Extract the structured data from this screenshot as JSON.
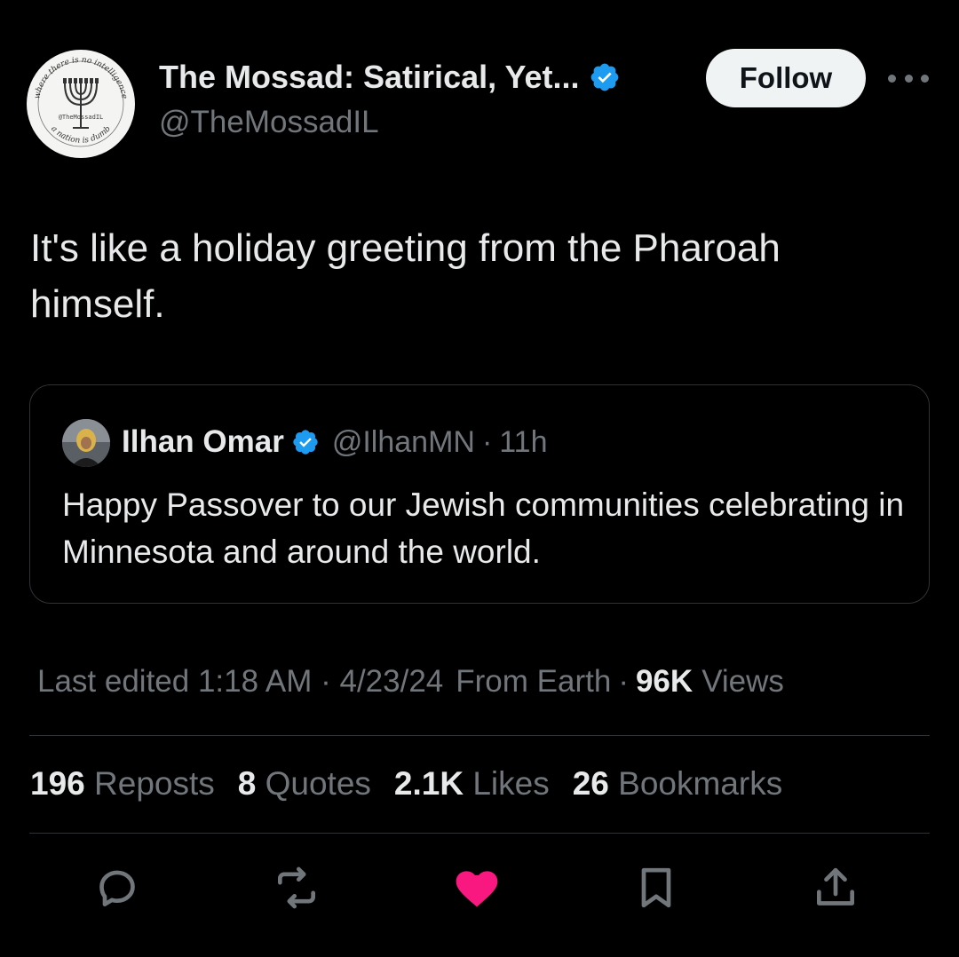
{
  "author": {
    "display_name": "The Mossad: Satirical, Yet...",
    "handle": "@TheMossadIL",
    "avatar": {
      "ring_top_text": "where there is no intelligence",
      "ring_bottom_text": "a nation is dumb",
      "center_text": "@TheMossadIL"
    }
  },
  "follow_label": "Follow",
  "tweet_text": "It's like a holiday greeting from the Pharoah himself.",
  "quote": {
    "name": "Ilhan Omar",
    "handle": "@IlhanMN",
    "separator": "·",
    "time": "11h",
    "text": "Happy Passover to our Jewish communities celebrating in Minnesota and around the world."
  },
  "meta": {
    "edited": "Last edited 1:18 AM · 4/23/24",
    "location": "From Earth",
    "separator": "·",
    "views_count": "96K",
    "views_label": "Views"
  },
  "stats": [
    {
      "count": "196",
      "label": "Reposts"
    },
    {
      "count": "8",
      "label": "Quotes"
    },
    {
      "count": "2.1K",
      "label": "Likes"
    },
    {
      "count": "26",
      "label": "Bookmarks"
    }
  ],
  "actions": [
    {
      "icon": "reply-icon"
    },
    {
      "icon": "repost-icon"
    },
    {
      "icon": "like-icon",
      "liked": true
    },
    {
      "icon": "bookmark-icon"
    },
    {
      "icon": "share-icon"
    }
  ],
  "colors": {
    "background": "#000000",
    "text_primary": "#e7e9ea",
    "text_secondary": "#71767b",
    "verified_blue": "#1d9bf0",
    "like_pink": "#f91880",
    "border": "#2f3336"
  }
}
